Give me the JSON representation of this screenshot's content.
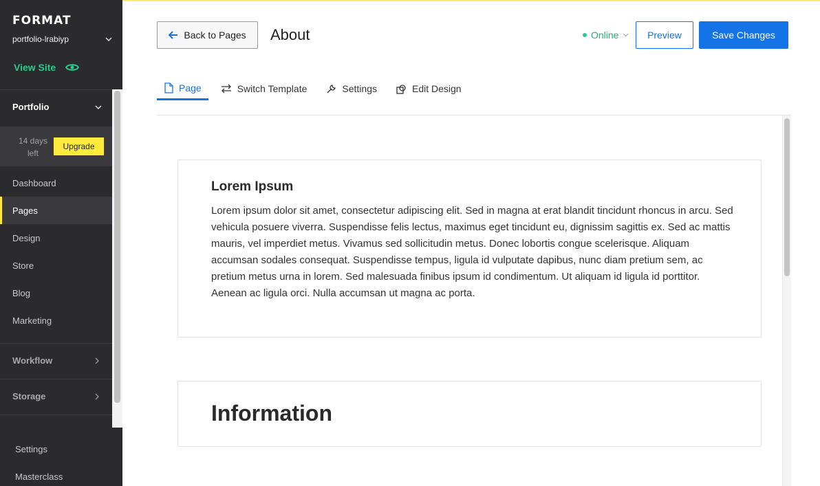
{
  "sidebar": {
    "logo": "FORMAT",
    "site_name": "portfolio-lrabiyp",
    "view_site": "View Site",
    "portfolio_label": "Portfolio",
    "trial_text": "14 days left",
    "upgrade_label": "Upgrade",
    "nav_items": [
      "Dashboard",
      "Pages",
      "Design",
      "Store",
      "Blog",
      "Marketing"
    ],
    "active_item": "Pages",
    "groups": [
      "Workflow",
      "Storage"
    ],
    "bottom_items": [
      "Settings",
      "Masterclass"
    ]
  },
  "header": {
    "back_label": "Back to Pages",
    "title": "About",
    "status": "Online",
    "preview_label": "Preview",
    "save_label": "Save Changes"
  },
  "tabs": [
    {
      "label": "Page",
      "icon": "page-icon",
      "active": true
    },
    {
      "label": "Switch Template",
      "icon": "switch-icon",
      "active": false
    },
    {
      "label": "Settings",
      "icon": "wrench-icon",
      "active": false
    },
    {
      "label": "Edit Design",
      "icon": "edit-design-icon",
      "active": false
    }
  ],
  "content": {
    "block1": {
      "heading": "Lorem Ipsum",
      "body": "Lorem ipsum dolor sit amet, consectetur adipiscing elit. Sed in magna at erat blandit tincidunt rhoncus in arcu. Sed vehicula posuere viverra. Suspendisse felis lectus, maximus eget tincidunt eu, dignissim sagittis ex. Sed ac mattis mauris, vel imperdiet metus. Vivamus sed sollicitudin metus. Donec lobortis congue scelerisque. Aliquam accumsan sodales consequat. Suspendisse tempus, ligula id vulputate dapibus, nunc diam pretium sem, ac pretium metus urna in lorem. Sed malesuada finibus ipsum id condimentum. Ut aliquam id ligula id porttitor. Aenean ac ligula orci. Nulla accumsan ut magna ac porta."
    },
    "block2": {
      "heading": "Information"
    }
  },
  "colors": {
    "accent": "#1473e6",
    "sidebar_bg": "#2b2b2e",
    "highlight": "#fcea3c",
    "online": "#2ec98f"
  }
}
